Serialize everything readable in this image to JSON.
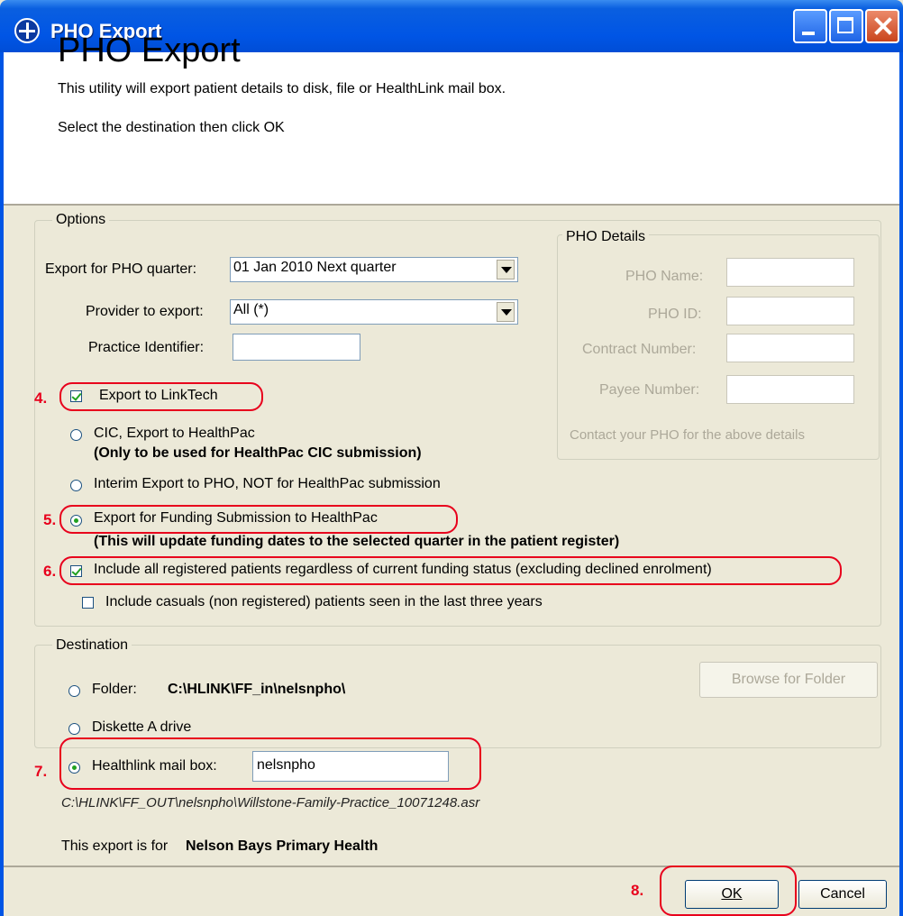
{
  "window": {
    "title": "PHO Export"
  },
  "header": {
    "title": "PHO Export",
    "description": "This utility will export patient details to disk, file or HealthLink mail box.",
    "instruction": "Select the destination then click OK"
  },
  "options": {
    "legend": "Options",
    "quarter_label": "Export for PHO quarter:",
    "quarter_value": "01 Jan 2010 Next quarter",
    "provider_label": "Provider to export:",
    "provider_value": "All (*)",
    "practice_label": "Practice Identifier:",
    "practice_value": "",
    "linktech_label": "Export to LinkTech",
    "linktech_checked": true,
    "cic_label": "CIC, Export to HealthPac",
    "cic_note": "(Only to be used for HealthPac CIC submission)",
    "interim_label": "Interim Export to PHO, NOT for HealthPac submission",
    "funding_label": "Export for Funding Submission to HealthPac",
    "funding_note": "(This will update funding dates to the selected quarter in the patient register)",
    "include_registered_label": "Include all registered patients regardless of current funding status (excluding declined enrolment)",
    "include_registered_checked": true,
    "include_casuals_label": "Include casuals (non registered) patients seen in the last three years",
    "include_casuals_checked": false
  },
  "pho_details": {
    "legend": "PHO Details",
    "name_label": "PHO Name:",
    "id_label": "PHO ID:",
    "contract_label": "Contract Number:",
    "payee_label": "Payee Number:",
    "contact_note": "Contact your PHO for the above details"
  },
  "destination": {
    "legend": "Destination",
    "folder_label": "Folder:",
    "folder_value": "C:\\HLINK\\FF_in\\nelsnpho\\",
    "browse_label": "Browse for Folder",
    "diskette_label": "Diskette A drive",
    "mailbox_label": "Healthlink mail box:",
    "mailbox_value": "nelsnpho",
    "output_path": "C:\\HLINK\\FF_OUT\\nelsnpho\\Willstone-Family-Practice_10071248.asr"
  },
  "footer": {
    "export_for_label": "This export is for",
    "export_for_value": "Nelson Bays Primary Health",
    "ok_label": "OK",
    "cancel_label": "Cancel"
  },
  "annotations": {
    "step4": "4.",
    "step5": "5.",
    "step6": "6.",
    "step7": "7.",
    "step8": "8."
  },
  "colors": {
    "annotation": "#e8001c",
    "titlebar": "#0055e5",
    "dialog_bg": "#ece9d8"
  }
}
